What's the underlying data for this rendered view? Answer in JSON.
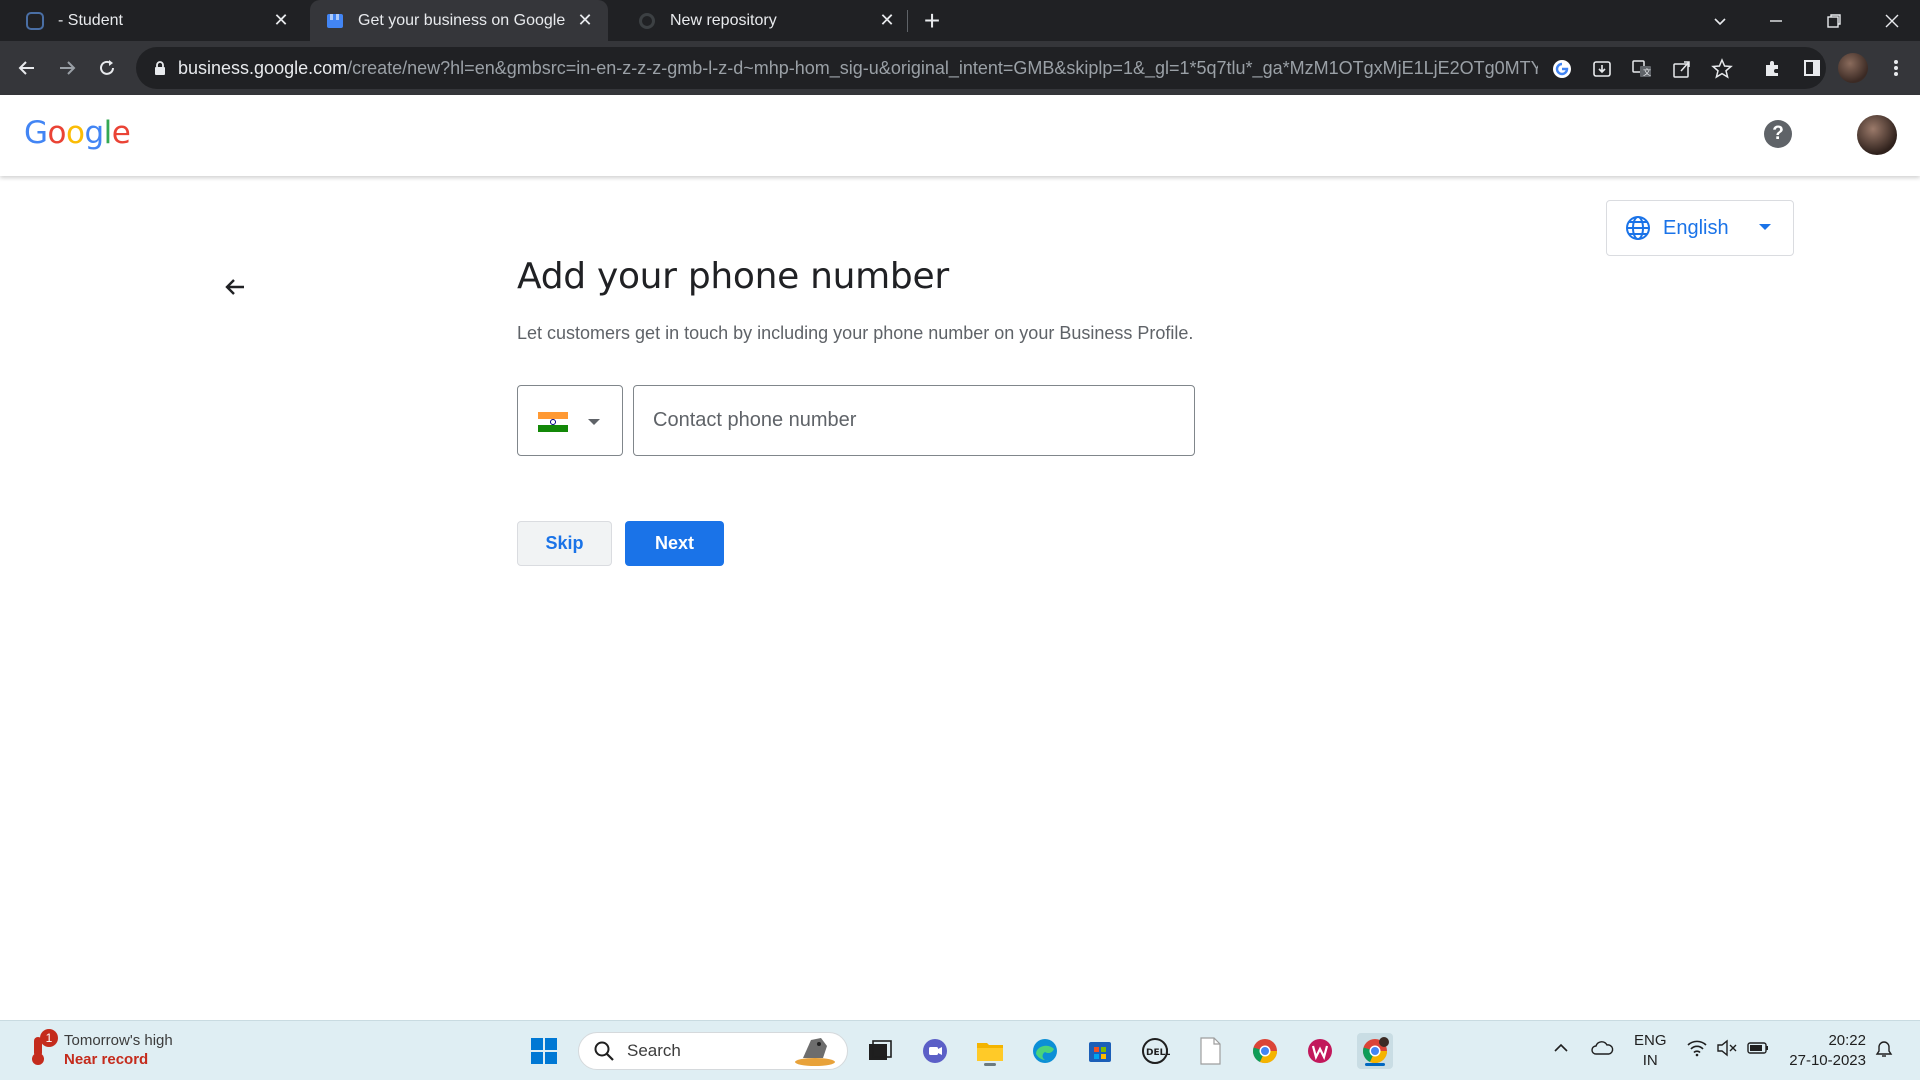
{
  "browser": {
    "tabs": [
      {
        "label": "- Student"
      },
      {
        "label": "Get your business on Google"
      },
      {
        "label": "New repository"
      }
    ],
    "url_host": "business.google.com",
    "url_path": "/create/new?hl=en&gmbsrc=in-en-z-z-z-gmb-l-z-d~mhp-hom_sig-u&original_intent=GMB&skiplp=1&_gl=1*5q7tlu*_ga*MzM1OTgxMjE1LjE2OTg0MTY..."
  },
  "header": {
    "logo": "Google"
  },
  "language": {
    "selected": "English"
  },
  "form": {
    "title": "Add your phone number",
    "subtitle": "Let customers get in touch by including your phone number on your Business Profile.",
    "phone_placeholder": "Contact phone number",
    "skip_label": "Skip",
    "next_label": "Next"
  },
  "taskbar": {
    "weather_line1": "Tomorrow's high",
    "weather_line2": "Near record",
    "weather_badge": "1",
    "search_label": "Search",
    "lang_line1": "ENG",
    "lang_line2": "IN",
    "time": "20:22",
    "date": "27-10-2023"
  },
  "colors": {
    "accent": "#1a73e8",
    "chrome_dark": "#202124",
    "taskbar": "#dfeef3"
  }
}
